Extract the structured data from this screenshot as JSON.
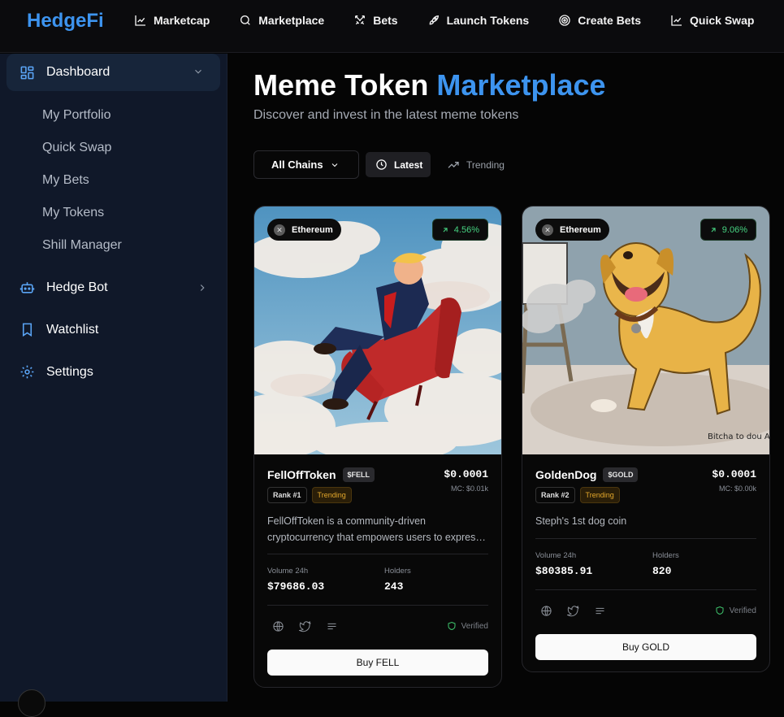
{
  "brand": "HedgeFi",
  "nav": [
    {
      "label": "Marketcap",
      "icon": "chart-line-icon"
    },
    {
      "label": "Marketplace",
      "icon": "search-icon"
    },
    {
      "label": "Bets",
      "icon": "swords-icon"
    },
    {
      "label": "Launch Tokens",
      "icon": "rocket-icon"
    },
    {
      "label": "Create Bets",
      "icon": "target-icon"
    },
    {
      "label": "Quick Swap",
      "icon": "chart-line-icon"
    }
  ],
  "sidebar": {
    "dashboard": "Dashboard",
    "sub": [
      "My Portfolio",
      "Quick Swap",
      "My Bets",
      "My Tokens",
      "Shill Manager"
    ],
    "hedge_bot": "Hedge Bot",
    "watchlist": "Watchlist",
    "settings": "Settings"
  },
  "page": {
    "title_main": "Meme Token",
    "title_accent": "Marketplace",
    "subtitle": "Discover and invest in the latest meme tokens"
  },
  "filters": {
    "chains": "All Chains",
    "latest": "Latest",
    "trending": "Trending"
  },
  "cards": [
    {
      "chain": "Ethereum",
      "change": "4.56%",
      "name": "FellOffToken",
      "ticker": "$FELL",
      "price": "$0.0001",
      "mc": "MC: $0.01k",
      "rank": "Rank #1",
      "trend_badge": "Trending",
      "desc_line1": "FellOffToken is a community-driven",
      "desc_line2": "cryptocurrency that empowers users to express themselves",
      "volume_label": "Volume 24h",
      "volume": "$79686.03",
      "holders_label": "Holders",
      "holders": "243",
      "verified": "Verified",
      "buy": "Buy FELL"
    },
    {
      "chain": "Ethereum",
      "change": "9.06%",
      "name": "GoldenDog",
      "ticker": "$GOLD",
      "price": "$0.0001",
      "mc": "MC: $0.00k",
      "rank": "Rank #2",
      "trend_badge": "Trending",
      "desc_line1": "Steph's 1st dog coin",
      "volume_label": "Volume 24h",
      "volume": "$80385.91",
      "holders_label": "Holders",
      "holders": "820",
      "verified": "Verified",
      "buy": "Buy GOLD",
      "image_caption": "Bitcha to dou Alyxdgs-"
    }
  ],
  "colors": {
    "brand": "#3d94ef",
    "positive": "#47d482",
    "trending": "#e3a72b",
    "sidebar_bg": "#101829"
  }
}
